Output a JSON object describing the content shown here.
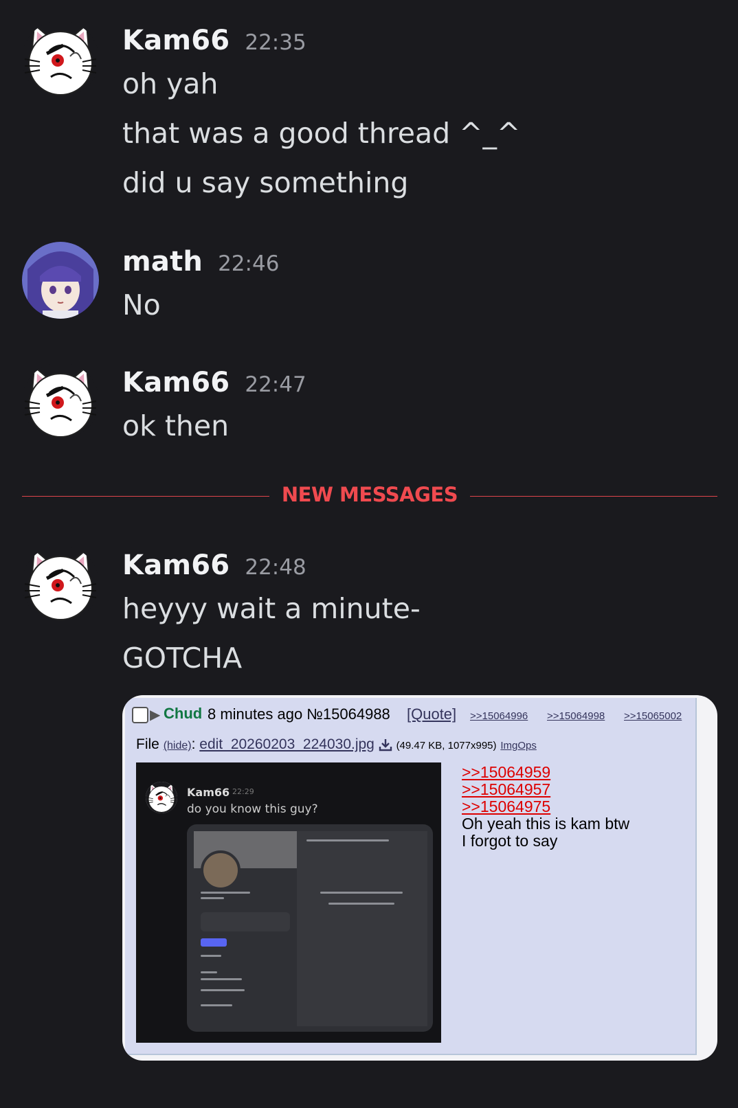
{
  "messages": [
    {
      "author": "Kam66",
      "time": "22:35",
      "lines": [
        "oh yah",
        "that was a good thread ^_^",
        "did u say something"
      ]
    },
    {
      "author": "math",
      "time": "22:46",
      "lines": [
        "No"
      ]
    },
    {
      "author": "Kam66",
      "time": "22:47",
      "lines": [
        "ok then"
      ]
    },
    {
      "author": "Kam66",
      "time": "22:48",
      "lines": [
        "heyyy wait a minute-",
        "GOTCHA"
      ]
    }
  ],
  "divider": {
    "label": "NEW MESSAGES",
    "color": "#ef4a4f"
  },
  "attachment": {
    "post": {
      "name": "Chud",
      "meta": "8 minutes ago №15064988",
      "quote": "[Quote]",
      "replies": [
        ">>15064996",
        ">>15064998",
        ">>15065002"
      ]
    },
    "file": {
      "label": "File",
      "hide": "(hide)",
      "colon": ":",
      "filename": "edit_20260203_224030.jpg",
      "meta": "(49.47 KB, 1077x995)",
      "imgops": "ImgOps"
    },
    "thumbnail": {
      "author": "Kam66",
      "time": "22:29",
      "text": "do you know this guy?"
    },
    "quotelinks": [
      ">>15064959",
      ">>15064957",
      ">>15064975"
    ],
    "body": [
      "Oh yeah this is kam btw",
      "I forgot to say"
    ]
  },
  "icons": {
    "kam_avatar": "white-cat-avatar-icon",
    "math_avatar": "anime-girl-avatar-icon",
    "download": "download-icon",
    "checkbox": "checkbox-icon",
    "expand": "triangle-right-icon"
  },
  "colors": {
    "background": "#1a1a1e",
    "accent_red": "#ef4a4f",
    "chan_bg": "#d6daf0",
    "chan_name": "#117743",
    "quotelink": "#dd0000"
  }
}
